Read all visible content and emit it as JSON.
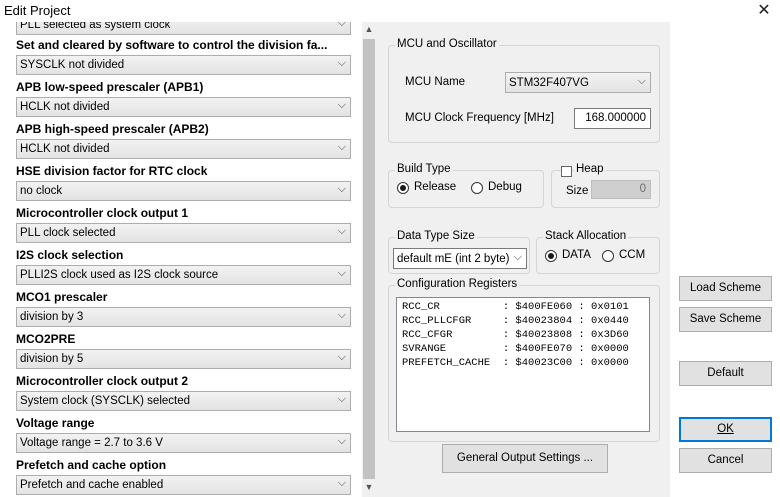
{
  "window": {
    "title": "Edit Project",
    "close_symbol": "✕"
  },
  "properties": [
    {
      "label": "",
      "value": "PLL selected as system clock"
    },
    {
      "label": "Set and cleared by software to control the division fa...",
      "value": "SYSCLK not divided"
    },
    {
      "label": "APB low-speed prescaler (APB1)",
      "value": "HCLK not divided"
    },
    {
      "label": "APB high-speed prescaler (APB2)",
      "value": "HCLK not divided"
    },
    {
      "label": "HSE division factor for RTC clock",
      "value": "no clock"
    },
    {
      "label": "Microcontroller clock output 1",
      "value": "PLL clock selected"
    },
    {
      "label": "I2S clock selection",
      "value": "PLLI2S clock used as I2S clock source"
    },
    {
      "label": "MCO1 prescaler",
      "value": "division by 3"
    },
    {
      "label": "MCO2PRE",
      "value": "division by 5"
    },
    {
      "label": "Microcontroller clock output 2",
      "value": "System clock (SYSCLK) selected"
    },
    {
      "label": "Voltage range",
      "value": "Voltage range = 2.7 to 3.6 V"
    },
    {
      "label": "Prefetch and cache option",
      "value": "Prefetch and cache enabled"
    }
  ],
  "mcu_group": {
    "title": "MCU and Oscillator",
    "mcu_name_label": "MCU Name",
    "mcu_name_value": "STM32F407VG",
    "freq_label": "MCU Clock Frequency [MHz]",
    "freq_value": "168.000000"
  },
  "build_type": {
    "title": "Build Type",
    "release": "Release",
    "debug": "Debug",
    "selected": "Release"
  },
  "heap": {
    "title": "Heap",
    "size_label": "Size",
    "size_value": "0",
    "checked": false
  },
  "data_type": {
    "title": "Data Type Size",
    "value": "default mE (int 2 byte)"
  },
  "stack": {
    "title": "Stack Allocation",
    "data": "DATA",
    "ccm": "CCM",
    "selected": "DATA"
  },
  "config_registers": {
    "title": "Configuration Registers",
    "lines": [
      "RCC_CR          : $400FE060 : 0x0101",
      "RCC_PLLCFGR     : $40023804 : 0x0440",
      "RCC_CFGR        : $40023808 : 0x3D60",
      "SVRANGE         : $400FE070 : 0x0000",
      "PREFETCH_CACHE  : $40023C00 : 0x0000"
    ]
  },
  "buttons": {
    "general_output": "General Output Settings ...",
    "load_scheme": "Load Scheme",
    "save_scheme": "Save Scheme",
    "default": "Default",
    "ok": "OK",
    "cancel": "Cancel"
  },
  "icons": {
    "dropdown": "chevron-down-icon",
    "scroll_up": "scroll-up-icon",
    "scroll_down": "scroll-down-icon"
  }
}
